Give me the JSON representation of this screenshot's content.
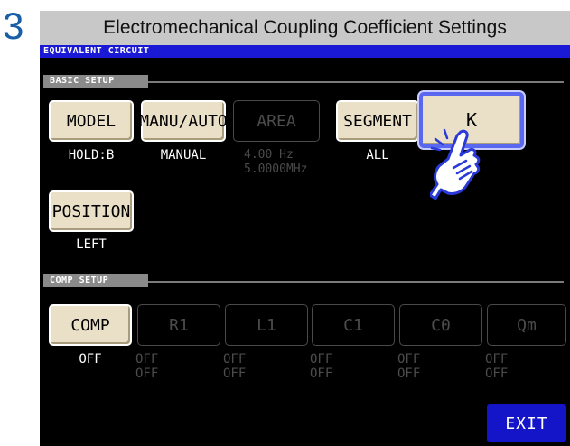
{
  "step_number": "3",
  "title": "Electromechanical Coupling Coefficient Settings",
  "screen_tab": "EQUIVALENT CIRCUIT",
  "basic_setup": {
    "header": "BASIC SETUP",
    "buttons": [
      {
        "label": "MODEL",
        "value": "HOLD:B"
      },
      {
        "label": "MANU/AUTO",
        "value": "MANUAL"
      },
      {
        "label": "AREA",
        "value_line1": "4.00 Hz",
        "value_line2": "5.0000MHz"
      },
      {
        "label": "SEGMENT",
        "value": "ALL"
      },
      {
        "label": "K"
      },
      {
        "label": "POSITION",
        "value": "LEFT"
      }
    ]
  },
  "comp_setup": {
    "header": "COMP SETUP",
    "comp": {
      "label": "COMP",
      "value": "OFF"
    },
    "buttons": [
      {
        "label": "R1",
        "v1": "OFF",
        "v2": "OFF"
      },
      {
        "label": "L1",
        "v1": "OFF",
        "v2": "OFF"
      },
      {
        "label": "C1",
        "v1": "OFF",
        "v2": "OFF"
      },
      {
        "label": "C0",
        "v1": "OFF",
        "v2": "OFF"
      },
      {
        "label": "Qm",
        "v1": "OFF",
        "v2": "OFF"
      }
    ]
  },
  "exit_label": "EXIT",
  "icons": {
    "pointer": "pointing-hand-icon"
  },
  "colors": {
    "highlight": "#5a68f0",
    "exit_button": "#1414c8",
    "tab_bar": "#1a1ad6",
    "button_face": "#eae0c8"
  }
}
